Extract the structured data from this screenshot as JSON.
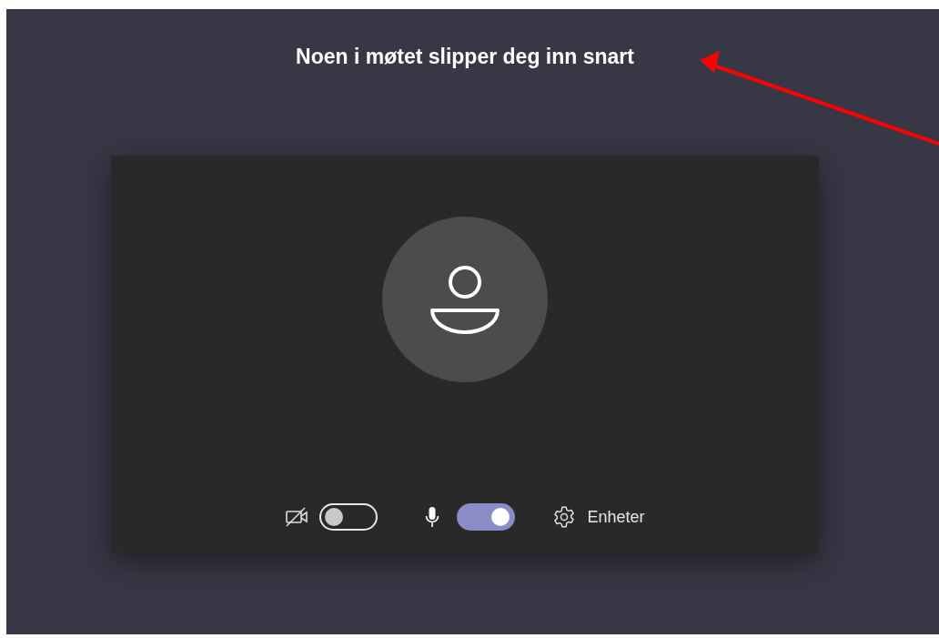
{
  "title": "Noen i møtet slipper deg inn snart",
  "camera": {
    "on": false
  },
  "microphone": {
    "on": true
  },
  "devices_button": {
    "label": "Enheter"
  }
}
